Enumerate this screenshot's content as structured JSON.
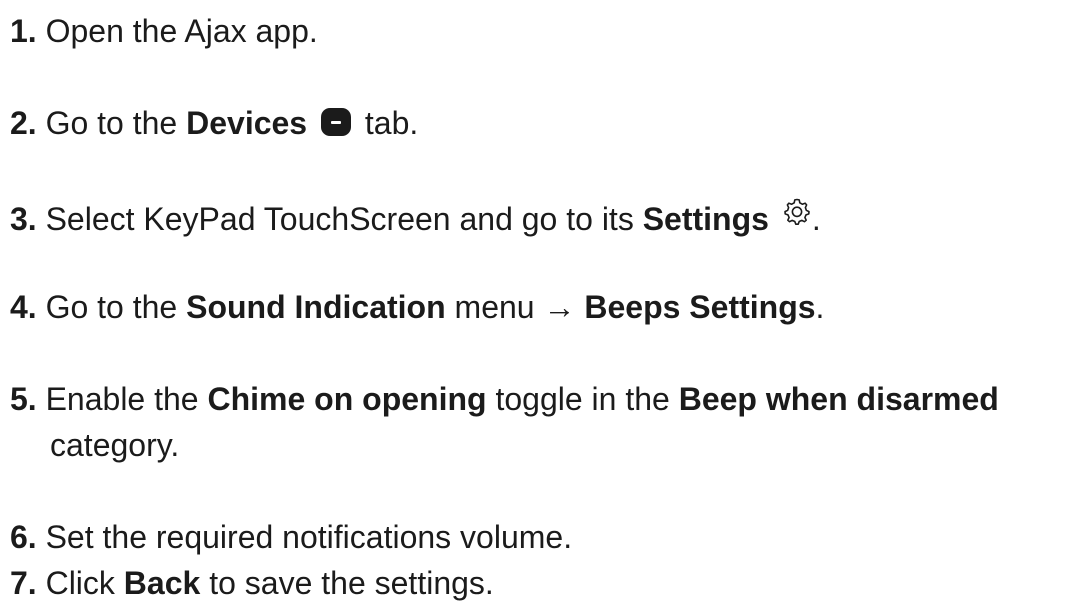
{
  "steps": [
    {
      "num": "1.",
      "text": "Open the Ajax app."
    },
    {
      "num": "2.",
      "pre": "Go to the ",
      "bold": "Devices",
      "icon": "devices-icon",
      "post": " tab."
    },
    {
      "num": "3.",
      "pre": "Select KeyPad TouchScreen and go to its ",
      "bold": "Settings",
      "icon": "gear-icon",
      "post": "."
    },
    {
      "num": "4.",
      "pre": "Go to the ",
      "bold1": "Sound Indication",
      "mid": " menu → ",
      "bold2": "Beeps Settings",
      "post": "."
    },
    {
      "num": "5.",
      "pre": "Enable the ",
      "bold1": "Chime on opening",
      "mid": " toggle in the ",
      "bold2": "Beep when disarmed",
      "post": "category."
    },
    {
      "num": "6.",
      "text": "Set the required notifications volume."
    },
    {
      "num": "7.",
      "pre": "Click ",
      "bold": "Back",
      "post": " to save the settings."
    }
  ]
}
